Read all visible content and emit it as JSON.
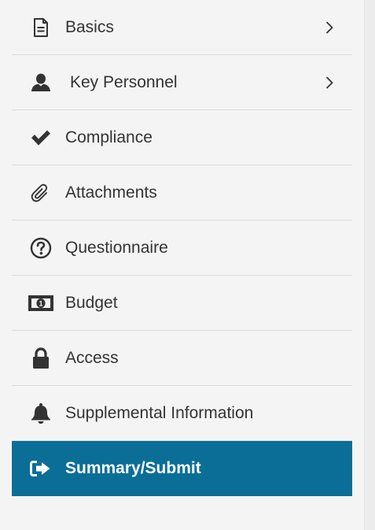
{
  "colors": {
    "sidebar_bg": "#f4f4f4",
    "active_bg": "#0a6e97",
    "text": "#333333",
    "active_text": "#ffffff",
    "divider": "#dcdcdc"
  },
  "nav": {
    "items": [
      {
        "label": "Basics",
        "icon": "document-icon",
        "has_chevron": true
      },
      {
        "label": "Key Personnel",
        "icon": "user-icon",
        "has_chevron": true
      },
      {
        "label": "Compliance",
        "icon": "checkmark-icon",
        "has_chevron": false
      },
      {
        "label": "Attachments",
        "icon": "paperclip-icon",
        "has_chevron": false
      },
      {
        "label": "Questionnaire",
        "icon": "question-circle-icon",
        "has_chevron": false
      },
      {
        "label": "Budget",
        "icon": "money-icon",
        "has_chevron": false
      },
      {
        "label": "Access",
        "icon": "lock-icon",
        "has_chevron": false
      },
      {
        "label": "Supplemental Information",
        "icon": "bell-icon",
        "has_chevron": false
      },
      {
        "label": "Summary/Submit",
        "icon": "sign-out-icon",
        "has_chevron": false,
        "active": true
      }
    ]
  }
}
